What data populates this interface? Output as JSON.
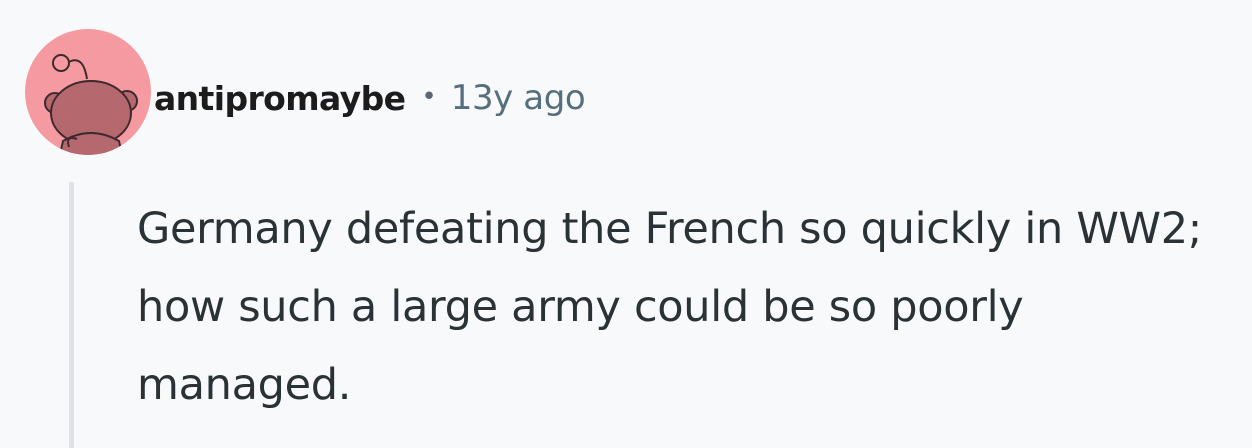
{
  "comment": {
    "author": {
      "username": "antipromaybe",
      "avatar_icon": "snoo-avatar-icon",
      "avatar_color": "#f59aa0"
    },
    "separator": "•",
    "timestamp": "13y ago",
    "body": "Germany defeating the French so quickly in WW2; how such a large army could be so poorly managed."
  },
  "colors": {
    "background": "#f8f9fb",
    "username": "#1c1c1c",
    "meta": "#576f7d",
    "body_text": "#2a3236",
    "thread_line": "#dfe3e8"
  }
}
